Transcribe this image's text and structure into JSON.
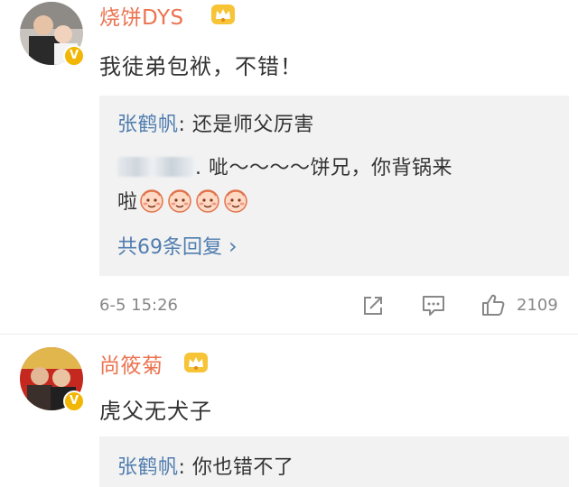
{
  "comments": [
    {
      "username": "烧饼DYS",
      "text": "我徒弟包袱，不错！",
      "replies": [
        {
          "author": "张鹤帆",
          "sep": ": ",
          "text": "还是师父厉害"
        },
        {
          "author_blurred": true,
          "text": ". 呲～～～～饼兄，你背锅来",
          "text_cont": "啦",
          "emoji_count": 4,
          "emoji_name": "smiling-face-emoji"
        }
      ],
      "more_replies": "共69条回复 ",
      "more_chevron": "›",
      "timestamp": "6-5 15:26",
      "likes": "2109",
      "verified_badge": "V",
      "icons": {
        "crown": "crown-badge-icon",
        "share": "share-icon",
        "comment": "comment-icon",
        "like": "thumbs-up-icon"
      }
    },
    {
      "username": "尚筱菊",
      "text": "虎父无犬子",
      "replies": [
        {
          "author": "张鹤帆",
          "sep": ": ",
          "text": "你也错不了"
        }
      ],
      "verified_badge": "V"
    }
  ],
  "colors": {
    "username": "#eb7350",
    "reply_name": "#507daf",
    "reply_bg": "#f2f2f2",
    "verified": "#f2b705",
    "meta": "#888888"
  }
}
